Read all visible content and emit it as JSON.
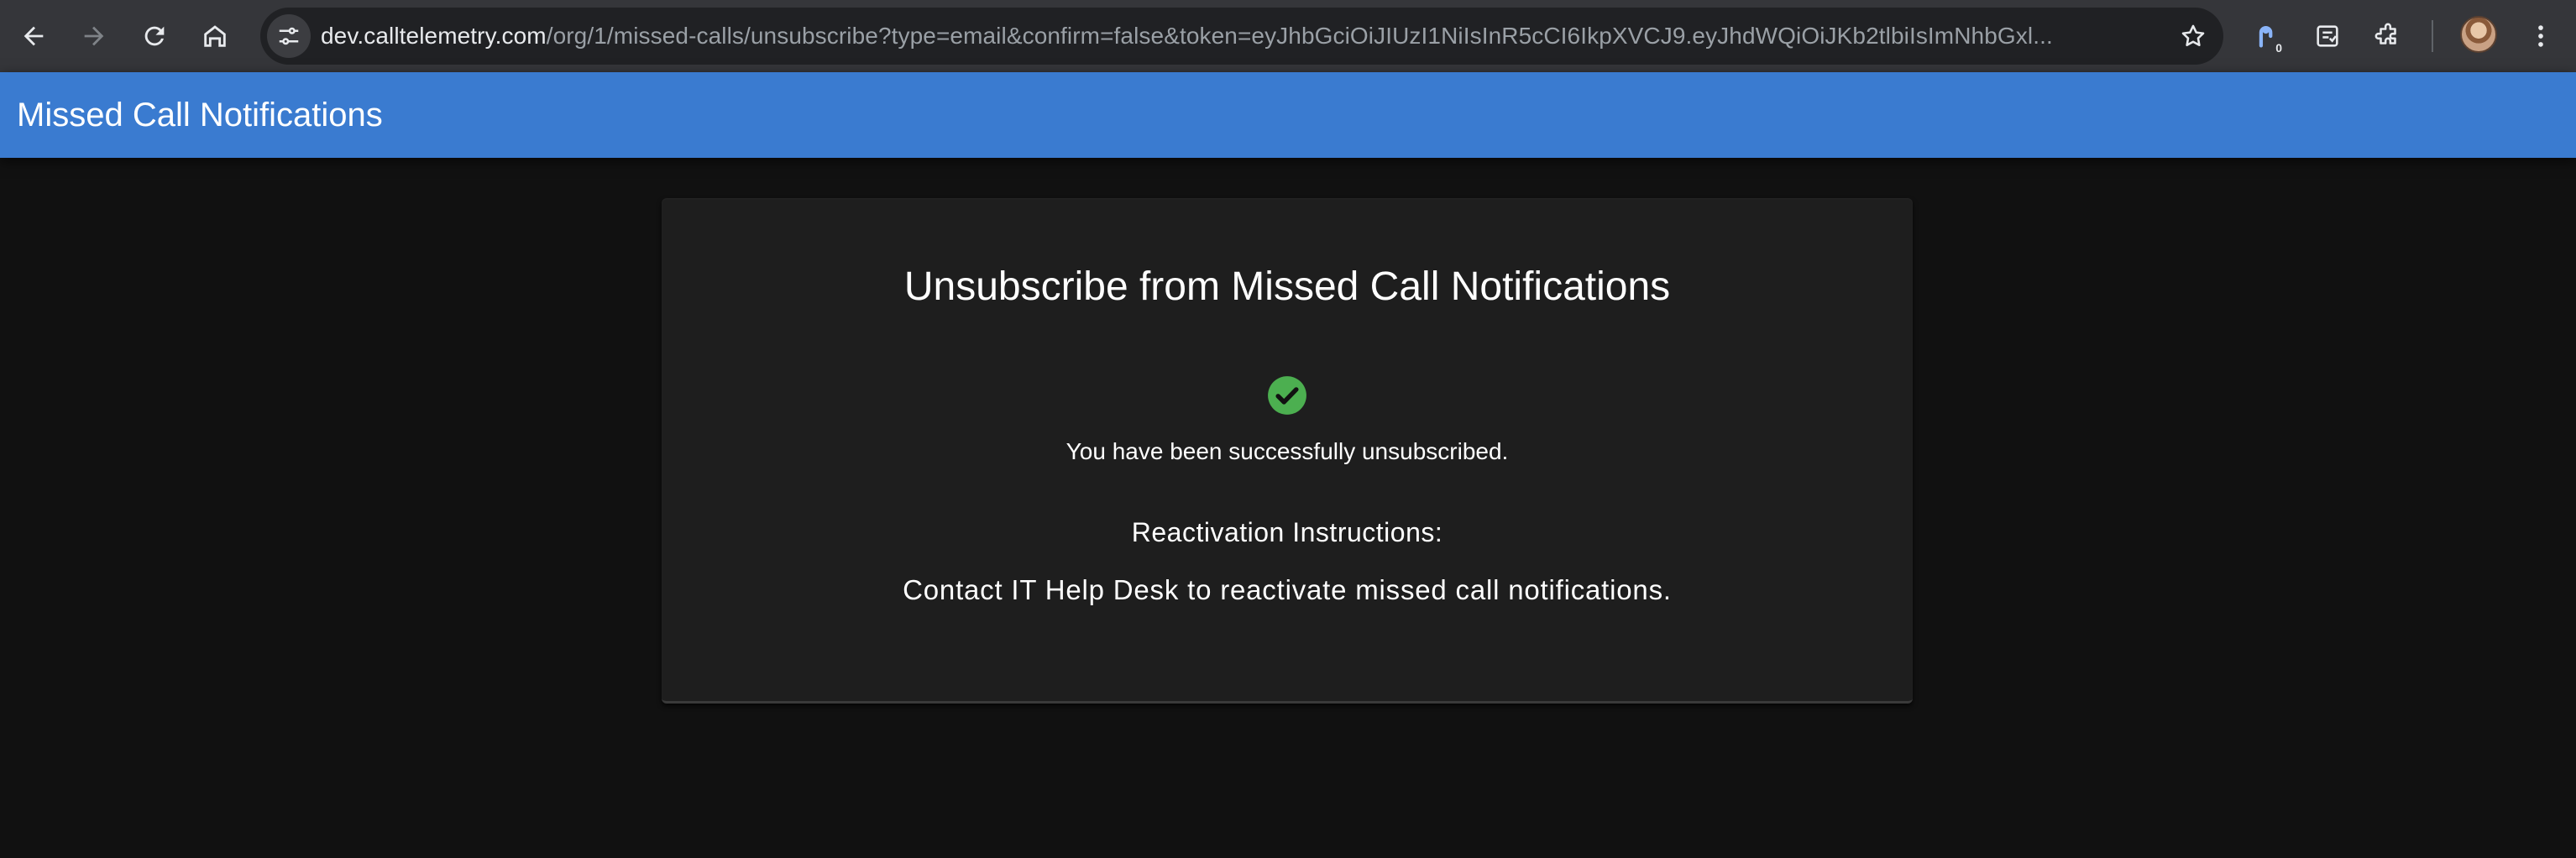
{
  "browser": {
    "url_host": "dev.calltelemetry.com",
    "url_path": "/org/1/missed-calls/unsubscribe?type=email&confirm=false&token=eyJhbGciOiJIUzI1NiIsInR5cCI6IkpXVCJ9.eyJhdWQiOiJKb2tlbiIsImNhbGxl...",
    "extension_badge": "0",
    "icons": {
      "back": "arrow-left-icon",
      "forward": "arrow-right-icon",
      "reload": "reload-icon",
      "home": "home-icon",
      "site_info": "tune-icon",
      "bookmark": "star-icon",
      "extension": "extension-icon",
      "reading_list": "reading-list-icon",
      "puzzle": "puzzle-icon",
      "menu": "more-vert-icon"
    }
  },
  "appbar": {
    "title": "Missed Call Notifications",
    "color": "#3a7bd0"
  },
  "card": {
    "title": "Unsubscribe from Missed Call Notifications",
    "status_icon": "check-circle-icon",
    "status_color": "#4caf50",
    "success_message": "You have been successfully unsubscribed.",
    "reactivation_heading": "Reactivation Instructions:",
    "reactivation_body": "Contact IT Help Desk to reactivate missed call notifications."
  }
}
